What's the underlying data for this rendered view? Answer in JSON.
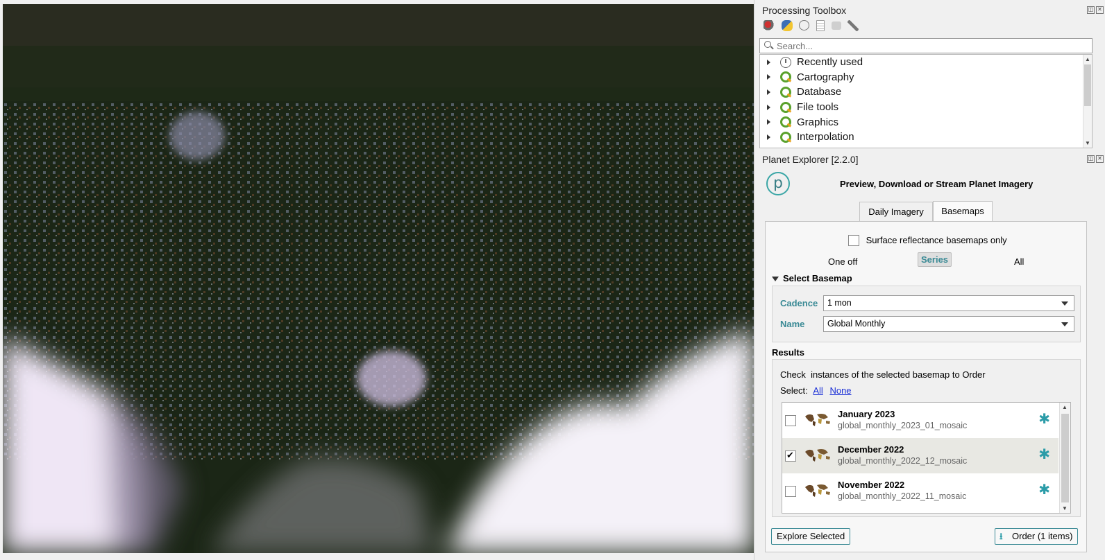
{
  "toolbox": {
    "title": "Processing Toolbox",
    "search_placeholder": "Search...",
    "items": [
      {
        "label": "Recently used",
        "icon": "clock-icon"
      },
      {
        "label": "Cartography",
        "icon": "qgis-icon"
      },
      {
        "label": "Database",
        "icon": "qgis-icon"
      },
      {
        "label": "File tools",
        "icon": "qgis-icon"
      },
      {
        "label": "Graphics",
        "icon": "qgis-icon"
      },
      {
        "label": "Interpolation",
        "icon": "qgis-icon"
      }
    ],
    "toolbar_icons": [
      "models-icon",
      "python-icon",
      "history-icon",
      "results-icon",
      "edit-features-icon",
      "options-icon"
    ]
  },
  "explorer": {
    "title": "Planet Explorer [2.2.0]",
    "logo_letter": "p",
    "heading": "Preview, Download or Stream Planet Imagery",
    "tabs": [
      "Daily Imagery",
      "Basemaps"
    ],
    "active_tab": "Basemaps",
    "surface_checkbox_label": "Surface reflectance basemaps only",
    "modes": [
      "One off",
      "Series",
      "All"
    ],
    "selected_mode": "Series",
    "select_basemap_label": "Select Basemap",
    "cadence_label": "Cadence",
    "cadence_value": "1 mon",
    "name_label": "Name",
    "name_value": "Global Monthly",
    "results_label": "Results",
    "results_hint": "Check  instances of the selected basemap to Order",
    "select_label": "Select:",
    "select_all": "All",
    "select_none": "None",
    "results": [
      {
        "title": "January 2023",
        "subtitle": "global_monthly_2023_01_mosaic",
        "checked": false
      },
      {
        "title": "December 2022",
        "subtitle": "global_monthly_2022_12_mosaic",
        "checked": true
      },
      {
        "title": "November 2022",
        "subtitle": "global_monthly_2022_11_mosaic",
        "checked": false
      }
    ],
    "explore_button": "Explore Selected",
    "order_button": "Order (1 items)"
  },
  "colors": {
    "accent": "#3a8a95",
    "gear": "#2b9ca8",
    "link": "#1a2fd6"
  }
}
